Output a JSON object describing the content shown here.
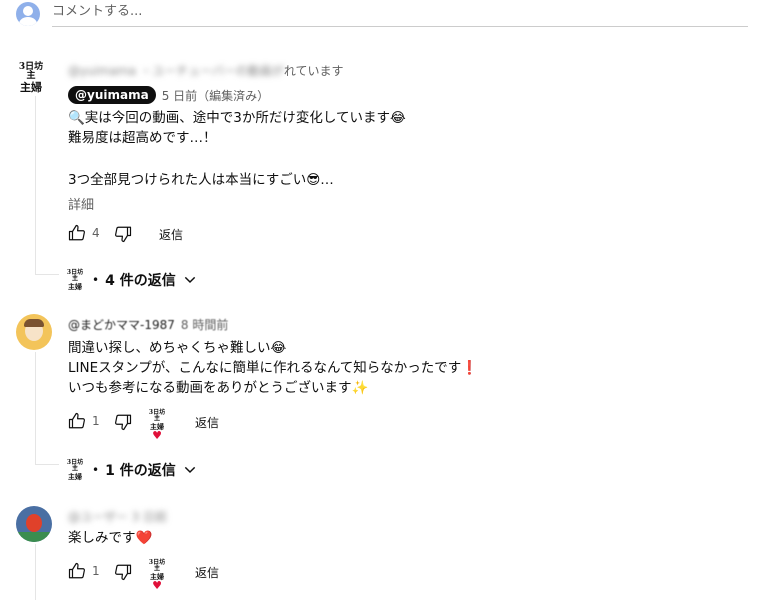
{
  "input": {
    "placeholder": "コメントする..."
  },
  "creator": {
    "logo_line1": "3日坊主",
    "logo_line2": "主婦"
  },
  "icons": {
    "like": "thumb-up-icon",
    "dislike": "thumb-down-icon",
    "expand": "chevron-down-icon",
    "heart": "heart-icon"
  },
  "comments": [
    {
      "author_obscured": "@yuimama ・ユーチューバーの動画が",
      "header_suffix": "れています",
      "handle": "@yuimama",
      "time": "5 日前（編集済み）",
      "line1": "🔍実は今回の動画、途中で3か所だけ変化しています😂",
      "line2": "難易度は超高めです…！",
      "line3": "3つ全部見つけられた人は本当にすごい😎…",
      "more": "詳細",
      "likes": "4",
      "reply": "返信",
      "replies": "4 件の返信"
    },
    {
      "author": "@まどかママ-1987",
      "time": "8 時間前",
      "line1": "間違い探し、めちゃくちゃ難しい😂",
      "line2": "LINEスタンプが、こんなに簡単に作れるなんて知らなかったです❗",
      "line3": "いつも参考になる動画をありがとうございます✨",
      "likes": "1",
      "reply": "返信",
      "replies": "1 件の返信"
    },
    {
      "author_obscured": "@ユーザー 3 日前",
      "line1": "楽しみです❤️",
      "likes": "1",
      "reply": "返信"
    }
  ]
}
